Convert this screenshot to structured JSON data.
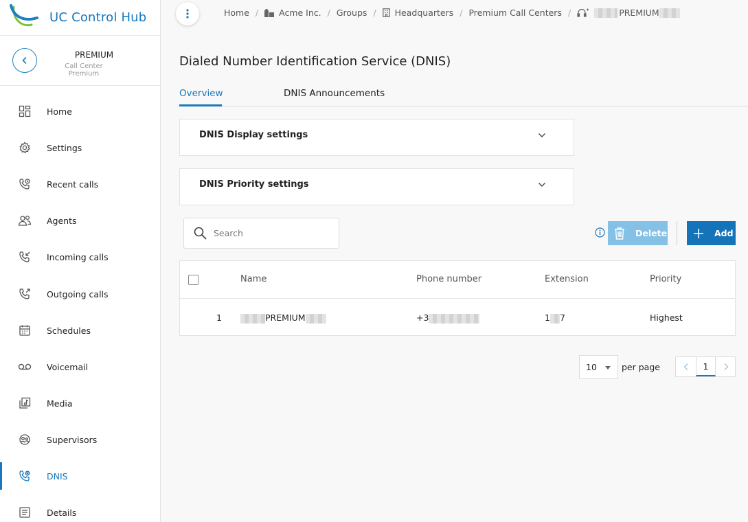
{
  "app": {
    "title": "UC Control Hub"
  },
  "context": {
    "name": "PREMIUM",
    "type": "Call Center Premium"
  },
  "sidebar": {
    "items": [
      {
        "label": "Home",
        "icon": "dashboard-icon"
      },
      {
        "label": "Settings",
        "icon": "gear-icon"
      },
      {
        "label": "Recent calls",
        "icon": "phone-clock-icon"
      },
      {
        "label": "Agents",
        "icon": "people-icon"
      },
      {
        "label": "Incoming calls",
        "icon": "phone-incoming-icon"
      },
      {
        "label": "Outgoing calls",
        "icon": "phone-outgoing-icon"
      },
      {
        "label": "Schedules",
        "icon": "calendar-icon"
      },
      {
        "label": "Voicemail",
        "icon": "voicemail-icon"
      },
      {
        "label": "Media",
        "icon": "media-icon"
      },
      {
        "label": "Supervisors",
        "icon": "supervisor-icon"
      },
      {
        "label": "DNIS",
        "icon": "phone-settings-icon",
        "active": true
      },
      {
        "label": "Details",
        "icon": "details-icon"
      }
    ]
  },
  "breadcrumb": {
    "home": "Home",
    "org": "Acme Inc.",
    "groups": "Groups",
    "hq": "Headquarters",
    "centers": "Premium Call Centers",
    "current": "PREMIUM"
  },
  "page": {
    "title": "Dialed Number Identification Service (DNIS)"
  },
  "tabs": {
    "overview": "Overview",
    "announcements": "DNIS Announcements"
  },
  "panels": {
    "display": "DNIS Display settings",
    "priority": "DNIS Priority settings"
  },
  "search": {
    "placeholder": "Search"
  },
  "actions": {
    "delete": "Delete",
    "add": "Add"
  },
  "table": {
    "columns": {
      "name": "Name",
      "phone": "Phone number",
      "extension": "Extension",
      "priority": "Priority"
    },
    "rows": [
      {
        "index": "1",
        "name": "PREMIUM",
        "phone_prefix": "+3",
        "ext_start": "1",
        "ext_end": "7",
        "priority": "Highest"
      }
    ]
  },
  "pagination": {
    "per_page": "10",
    "per_page_label": "per page",
    "current_page": "1"
  },
  "colors": {
    "accent": "#1877bd",
    "add_button": "#1573ba",
    "delete_button_disabled": "#85c0e6"
  }
}
